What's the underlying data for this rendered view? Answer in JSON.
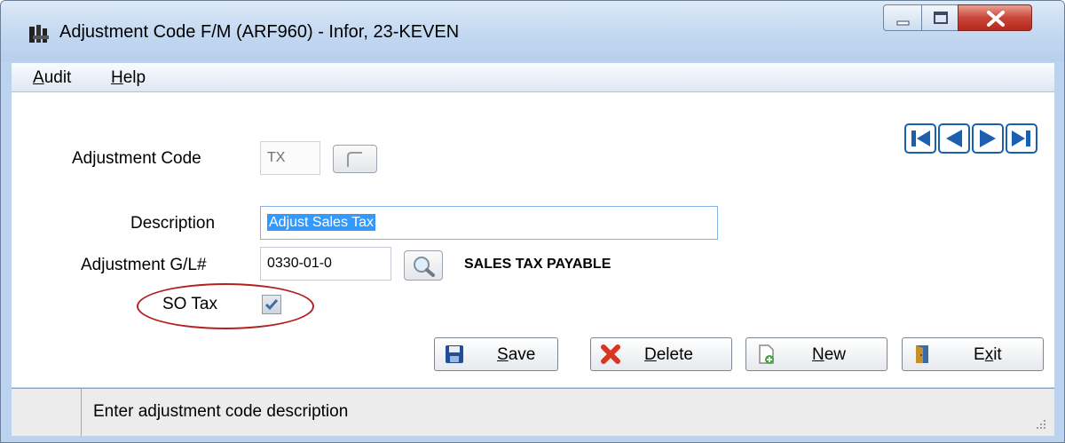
{
  "window": {
    "title": "Adjustment Code F/M (ARF960) - Infor, 23-KEVEN",
    "controls": [
      "minimize-icon",
      "maximize-icon",
      "close-icon"
    ]
  },
  "menu": {
    "audit": {
      "accel": "A",
      "rest": "udit"
    },
    "help": {
      "accel": "H",
      "rest": "elp"
    }
  },
  "form": {
    "adjustment_code": {
      "label": "Adjustment Code",
      "value": "TX"
    },
    "description": {
      "label": "Description",
      "value": "Adjust Sales Tax"
    },
    "gl": {
      "label": "Adjustment G/L#",
      "value": "0330-01-0",
      "account_name": "SALES TAX PAYABLE"
    },
    "so_tax": {
      "label": "SO Tax",
      "checked": true
    }
  },
  "nav_icons": [
    "first-record-icon",
    "previous-record-icon",
    "next-record-icon",
    "last-record-icon"
  ],
  "buttons": {
    "save": {
      "accel": "S",
      "rest": "ave",
      "icon": "floppy-disk-icon"
    },
    "delete": {
      "accel": "D",
      "rest": "elete",
      "icon": "red-x-icon"
    },
    "new": {
      "accel": "N",
      "rest": "ew",
      "icon": "new-document-icon"
    },
    "exit": {
      "pre": "E",
      "accel": "x",
      "rest": "it",
      "icon": "exit-door-icon"
    }
  },
  "status": {
    "message": "Enter adjustment code description"
  },
  "colors": {
    "annotation_circle": "#b32222",
    "nav_blue": "#1a5fb0",
    "selection": "#3399ff"
  }
}
